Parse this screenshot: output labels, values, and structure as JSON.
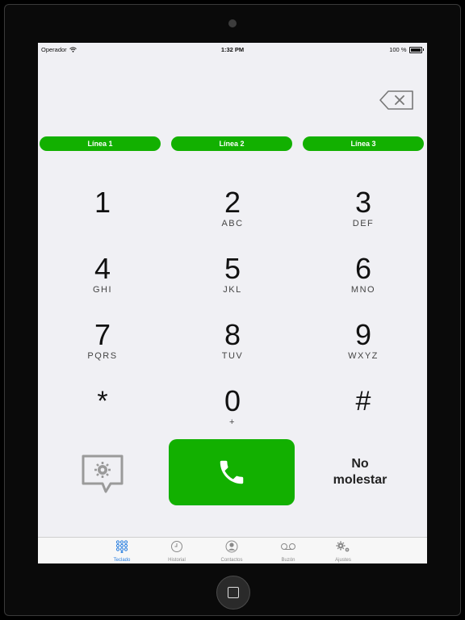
{
  "status_bar": {
    "carrier": "Operador",
    "time": "1:32 PM",
    "battery": "100 %"
  },
  "lines": [
    {
      "label": "Línea 1"
    },
    {
      "label": "Línea 2"
    },
    {
      "label": "Línea 3"
    }
  ],
  "keypad": [
    {
      "digit": "1",
      "letters": ""
    },
    {
      "digit": "2",
      "letters": "ABC"
    },
    {
      "digit": "3",
      "letters": "DEF"
    },
    {
      "digit": "4",
      "letters": "GHI"
    },
    {
      "digit": "5",
      "letters": "JKL"
    },
    {
      "digit": "6",
      "letters": "MNO"
    },
    {
      "digit": "7",
      "letters": "PQRS"
    },
    {
      "digit": "8",
      "letters": "TUV"
    },
    {
      "digit": "9",
      "letters": "WXYZ"
    },
    {
      "digit": "*",
      "letters": ""
    },
    {
      "digit": "0",
      "letters": "+"
    },
    {
      "digit": "#",
      "letters": ""
    }
  ],
  "actions": {
    "dnd_line1": "No",
    "dnd_line2": "molestar"
  },
  "tabs": [
    {
      "label": "Teclado",
      "icon": "keypad-icon",
      "active": true
    },
    {
      "label": "Historial",
      "icon": "clock-icon",
      "active": false
    },
    {
      "label": "Contactos",
      "icon": "contact-icon",
      "active": false
    },
    {
      "label": "Buzón",
      "icon": "voicemail-icon",
      "active": false
    },
    {
      "label": "Ajustes",
      "icon": "gears-icon",
      "active": false
    }
  ],
  "colors": {
    "accent_green": "#12b000",
    "active_tab": "#2a7fe0",
    "screen_bg": "#f0f0f4"
  }
}
